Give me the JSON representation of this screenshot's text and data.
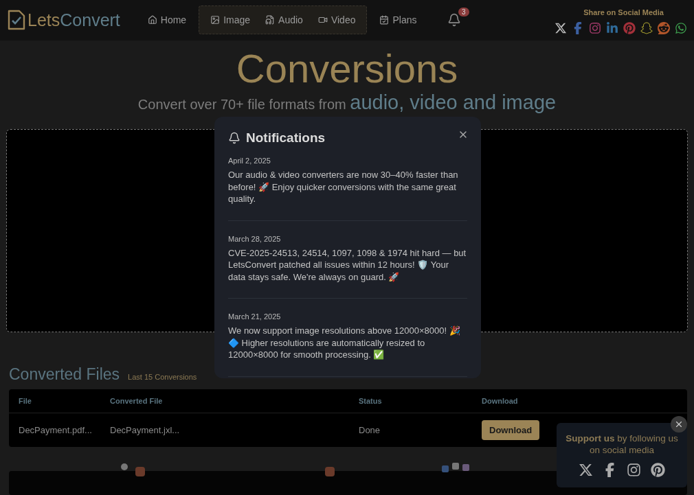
{
  "header": {
    "logo": {
      "first": "Lets",
      "second": "Convert"
    },
    "nav": [
      {
        "label": "Home",
        "kind": "home",
        "grouped": false
      },
      {
        "label": "Image",
        "kind": "image",
        "grouped": true
      },
      {
        "label": "Audio",
        "kind": "audio",
        "grouped": true
      },
      {
        "label": "Video",
        "kind": "video",
        "grouped": true
      },
      {
        "label": "Plans",
        "kind": "plans",
        "grouped": false
      }
    ],
    "notification_count": "3",
    "share": {
      "title": "Share on Social Media"
    }
  },
  "hero": {
    "title": "Conversions",
    "subtitle": "Convert over 70+ file formats from",
    "subtitle_highlight": "audio, video and image"
  },
  "notifications": {
    "title": "Notifications",
    "items": [
      {
        "date": "April 2, 2025",
        "text": "Our audio & video converters are now 30–40% faster than before! 🚀 Enjoy quicker conversions with the same great quality."
      },
      {
        "date": "March 28, 2025",
        "text": "CVE-2025-24513, 24514, 1097, 1098 & 1974 hit hard — but LetsConvert patched all issues within 12 hours! 🛡️ Your data stays safe. We're always on guard. 🚀"
      },
      {
        "date": "March 21, 2025",
        "text": "We now support image resolutions above 12000×8000! 🎉 🔷 Higher resolutions are automatically resized to 12000×8000 for smooth processing. ✅"
      }
    ]
  },
  "converted": {
    "title": "Converted Files",
    "caption": "Last 15 Conversions",
    "columns": [
      "File",
      "Converted File",
      "Status",
      "Download"
    ],
    "rows": [
      {
        "file": "DecPayment.pdf...",
        "converted": "DecPayment.jxl...",
        "status": "Done",
        "action": "Download"
      }
    ]
  },
  "support": {
    "text": "**Support us** by following us on social media"
  }
}
